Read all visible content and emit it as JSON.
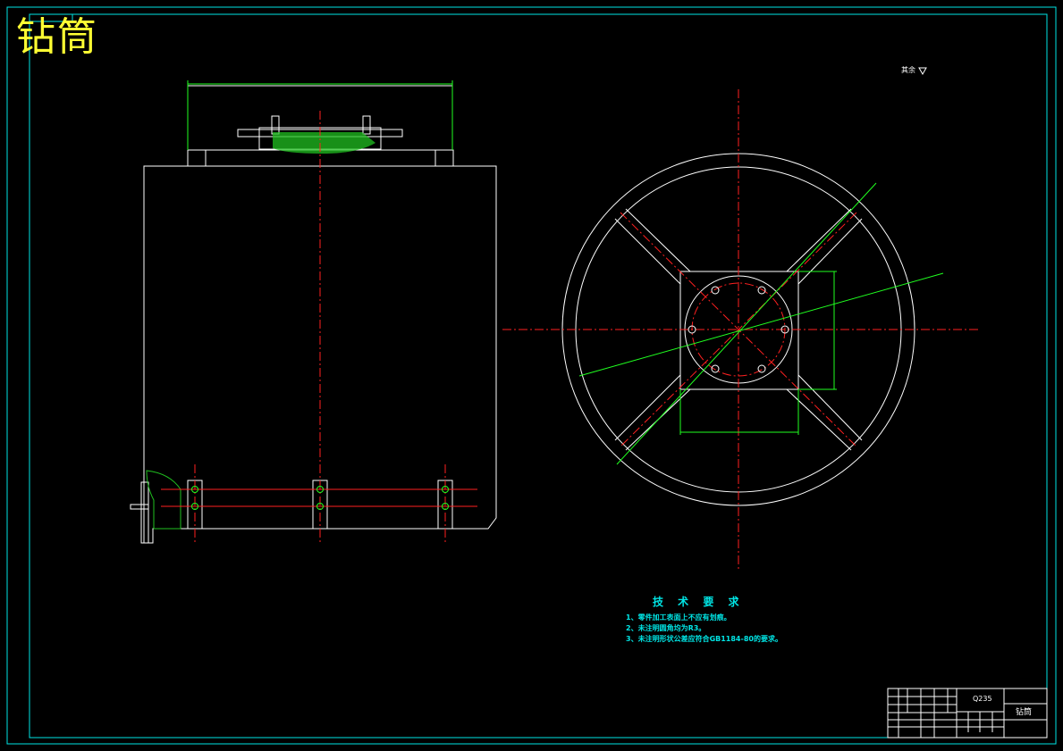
{
  "title": "钻筒",
  "roughness_note": "其余",
  "technical_requirements": {
    "heading": "技 术 要 求",
    "items": [
      "1、零件加工表面上不应有划痕。",
      "2、未注明圆角均为R3。",
      "3、未注明形状公差应符合GB1184-80的要求。"
    ]
  },
  "title_block": {
    "material": "Q235",
    "part_name": "钻筒"
  },
  "colors": {
    "background": "#000000",
    "outline": "#ffffff",
    "frame": "#00e5e5",
    "centerline": "#ff2020",
    "dimension": "#20ff20",
    "hatch": "#20c020",
    "title": "#ffff33"
  }
}
